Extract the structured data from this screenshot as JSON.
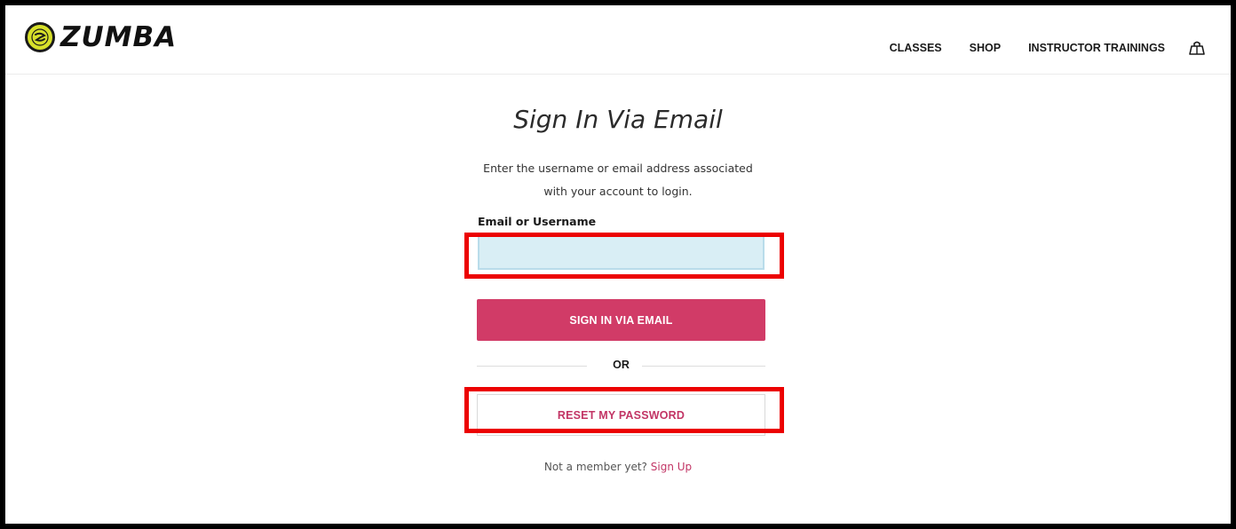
{
  "header": {
    "logo_text": "ZUMBA",
    "logo_icon": "zumba-logo-icon",
    "nav": [
      "CLASSES",
      "SHOP",
      "INSTRUCTOR TRAININGS"
    ],
    "cart_icon": "shopping-bag-icon"
  },
  "main": {
    "title": "Sign In Via Email",
    "description_line1": "Enter the username or email address associated",
    "description_line2": "with your account to login.",
    "email_label": "Email or Username",
    "email_value": "",
    "sign_in_button": "SIGN IN VIA EMAIL",
    "or_text": "OR",
    "reset_button": "RESET MY PASSWORD",
    "signup_prompt": "Not a member yet?",
    "signup_link": "Sign Up"
  },
  "colors": {
    "accent": "#d13b67",
    "link": "#c23565",
    "highlight": "#ec0000",
    "input_bg": "#d9eef5"
  }
}
